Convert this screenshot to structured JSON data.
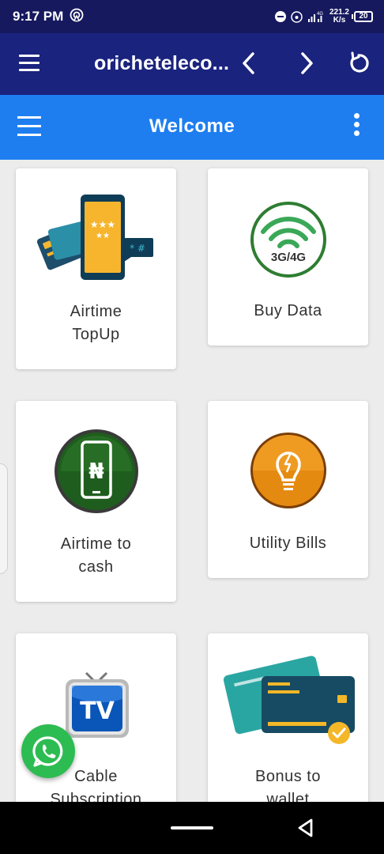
{
  "status": {
    "time": "9:17 PM",
    "network": "4G",
    "speed_value": "221.2",
    "speed_unit": "K/s",
    "battery": "20",
    "icons": [
      "hotspot-icon",
      "dnd-icon",
      "wifi-calling-icon",
      "signal-icon",
      "battery-icon"
    ]
  },
  "browser": {
    "title": "oricheteleco...",
    "icons": [
      "menu-icon",
      "back-icon",
      "forward-icon",
      "reload-icon"
    ]
  },
  "app_bar": {
    "title": "Welcome",
    "icons": [
      "hamburger-icon",
      "more-vert-icon"
    ],
    "color": "#1e7ef0"
  },
  "cards": [
    {
      "line1": "Airtime",
      "line2": "TopUp",
      "icon": "airtime-topup-icon"
    },
    {
      "line1": "Buy Data",
      "line2": "",
      "icon": "data-3g4g-icon",
      "icon_text": "3G/4G"
    },
    {
      "line1": "Airtime to",
      "line2": "cash",
      "icon": "airtime-cash-icon",
      "icon_text": "₦"
    },
    {
      "line1": "Utility Bills",
      "line2": "",
      "icon": "lightbulb-icon"
    },
    {
      "line1": "Cable",
      "line2": "Subscription",
      "icon": "tv-icon",
      "icon_text": "TV"
    },
    {
      "line1": "Bonus to",
      "line2": "wallet",
      "icon": "bank-card-icon"
    }
  ],
  "floating": {
    "icon": "whatsapp-icon"
  },
  "system_nav": {
    "icons": [
      "home-pill-icon",
      "back-triangle-icon"
    ]
  }
}
